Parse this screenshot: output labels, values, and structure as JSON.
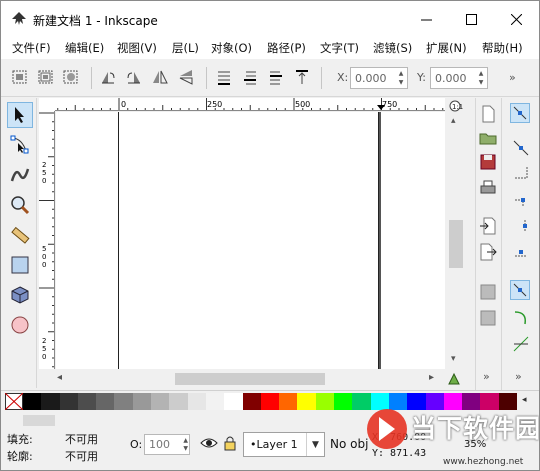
{
  "window": {
    "title": "新建文档 1 - Inkscape"
  },
  "menu": [
    "文件(F)",
    "编辑(E)",
    "视图(V)",
    "层(L)",
    "对象(O)",
    "路径(P)",
    "文字(T)",
    "滤镜(S)",
    "扩展(N)",
    "帮助(H)"
  ],
  "toolbar": {
    "x_label": "X:",
    "x_value": "0.000",
    "y_label": "Y:",
    "y_value": "0.000",
    "more": "»"
  },
  "ruler": {
    "h_labels": [
      "0",
      "250",
      "500",
      "750"
    ],
    "v_labels": [
      "2",
      "5",
      "0",
      "5",
      "0",
      "0",
      "2",
      "5",
      "0"
    ]
  },
  "status": {
    "fill_label": "填充:",
    "fill_value": "不可用",
    "stroke_label": "轮廓:",
    "stroke_value": "不可用",
    "opacity_label": "O:",
    "opacity_value": "100",
    "layer_name": "•Layer 1",
    "message": "No obj",
    "x_readout": "X: 760.00",
    "y_readout": "Y: 871.43",
    "zoom": "35%"
  },
  "watermark": {
    "brand": "当下软件园",
    "url": "www.hezhong.net"
  },
  "colors": {
    "palette": [
      "#000000",
      "#1a1a1a",
      "#333333",
      "#4d4d4d",
      "#666666",
      "#808080",
      "#999999",
      "#b3b3b3",
      "#cccccc",
      "#e6e6e6",
      "#f2f2f2",
      "#ffffff",
      "#800000",
      "#ff0000",
      "#ff6600",
      "#ffff00",
      "#99ff00",
      "#00ff00",
      "#00cc66",
      "#00ffff",
      "#0080ff",
      "#0000ff",
      "#6600ff",
      "#ff00ff",
      "#800080",
      "#cc0066",
      "#4d0000"
    ],
    "accent": "#cce4f7",
    "watermark_red": "#e63323"
  }
}
